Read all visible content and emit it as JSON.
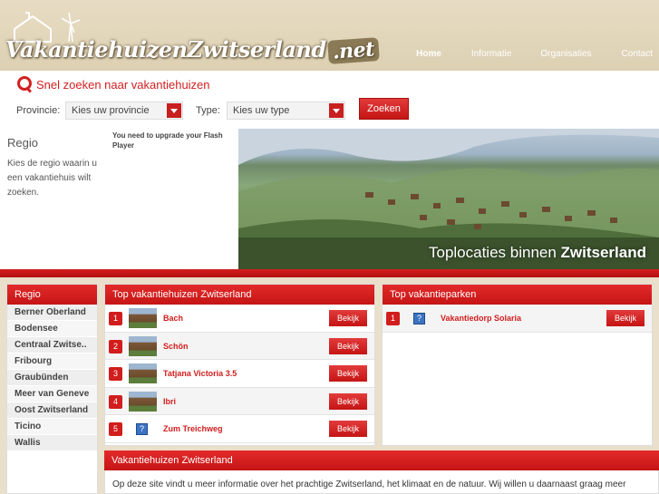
{
  "header": {
    "logo_text": "VakantiehuizenZwitserland",
    "logo_tld": ".net",
    "nav": [
      {
        "label": "Home",
        "active": true
      },
      {
        "label": "Informatie",
        "active": false
      },
      {
        "label": "Organisaties",
        "active": false
      },
      {
        "label": "Contact",
        "active": false
      }
    ]
  },
  "search": {
    "title": "Snel zoeken naar vakantiehuizen",
    "provincie_label": "Provincie:",
    "provincie_value": "Kies uw provincie",
    "type_label": "Type:",
    "type_value": "Kies uw type",
    "button_label": "Zoeken"
  },
  "regio_intro": {
    "title": "Regio",
    "text": "Kies de regio waarin u een vakantiehuis wilt zoeken."
  },
  "flash_notice": "You need to upgrade your Flash Player",
  "hero": {
    "caption_light": "Toplocaties binnen ",
    "caption_bold": "Zwitserland"
  },
  "regio_panel": {
    "title": "Regio",
    "items": [
      "Berner Oberland",
      "Bodensee",
      "Centraal Zwitse..",
      "Fribourg",
      "Graubünden",
      "Meer van Geneve",
      "Oost Zwitserland",
      "Ticino",
      "Wallis"
    ]
  },
  "top_huizen": {
    "title": "Top vakantiehuizen Zwitserland",
    "rows": [
      {
        "num": "1",
        "name": "Bach",
        "thumb": "photo",
        "button": "Bekijk"
      },
      {
        "num": "2",
        "name": "Schön",
        "thumb": "photo",
        "button": "Bekijk"
      },
      {
        "num": "3",
        "name": "Tatjana Victoria 3.5",
        "thumb": "photo",
        "button": "Bekijk"
      },
      {
        "num": "4",
        "name": "Ibri",
        "thumb": "photo",
        "button": "Bekijk"
      },
      {
        "num": "5",
        "name": "Zum Treichweg",
        "thumb": "placeholder-icon",
        "button": "Bekijk"
      }
    ]
  },
  "top_parken": {
    "title": "Top vakantieparken",
    "rows": [
      {
        "num": "1",
        "name": "Vakantiedorp Solaria",
        "thumb": "placeholder-icon",
        "button": "Bekijk"
      }
    ]
  },
  "about": {
    "title": "Vakantiehuizen Zwitserland",
    "text": "Op deze site vindt u meer informatie over het prachtige Zwitserland, het klimaat en de natuur. Wij willen u daarnaast graag meer vertellen over de"
  },
  "colors": {
    "accent": "#d21d1d",
    "header_bg": "#e3d7bc"
  }
}
